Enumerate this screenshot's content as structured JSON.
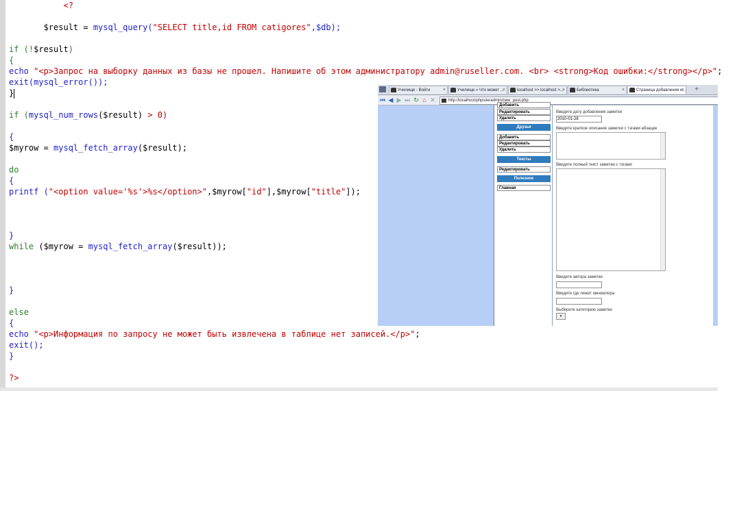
{
  "editor": {
    "lines": [
      {
        "y": 0,
        "parts": []
      },
      {
        "y": 1,
        "parts": []
      }
    ]
  },
  "code": {
    "l1": "<?",
    "l2_var": "$result = ",
    "l2_fn": "mysql_query",
    "l2_paren": "(",
    "l2_str": "\"SELECT title,id FROM catigores\"",
    "l2_tail": ",$db);",
    "l3_kw": "if (!",
    "l3_var": "$result",
    "l3_end": ")",
    "l4": "{",
    "l5_kw": "echo ",
    "l5_str": "\"<p>Запрос на выборку данных из базы не прошел. Напишите об этом администратору admin@ruseller.com. <br> <strong>Код ошибки:</strong></p>\"",
    "l5_end": ";",
    "l6_fn": "exit(mysql_error());",
    "l7": "}",
    "l8_kw": "if (",
    "l8_fn": "mysql_num_rows",
    "l8_var": "($result)",
    "l8_op": " > 0)",
    "l9": "{",
    "l10_var": "$myrow = ",
    "l10_fn": "mysql_fetch_array",
    "l10_tail": "($result);",
    "l11_kw": "do",
    "l12": "{",
    "l13_fn": "printf (",
    "l13_str": "\"<option value='%s'>%s</option>\"",
    "l13_mid": ",$myrow[",
    "l13_s1": "\"id\"",
    "l13_mid2": "],$myrow[",
    "l13_s2": "\"title\"",
    "l13_end": "]);",
    "l14": "}",
    "l15_kw": "while",
    "l15_var": " ($myrow = ",
    "l15_fn": "mysql_fetch_array",
    "l15_tail": "($result));",
    "l16": "}",
    "l17_kw": "else",
    "l18": "{",
    "l19_kw": "echo ",
    "l19_str": "\"<p>Информация по запросу не может быть извлечена в таблице нет записей.</p>\"",
    "l19_end": ";",
    "l20_fn": "exit();",
    "l21": "}",
    "l22": "?>"
  },
  "browser": {
    "tabs": [
      {
        "label": "Училище - Войти",
        "active": false
      },
      {
        "label": "Училище » Что может ...",
        "active": false
      },
      {
        "label": "localhost >> localhost >...",
        "active": false
      },
      {
        "label": "Библиотека",
        "active": false
      },
      {
        "label": "Страница добавления н...",
        "active": true
      }
    ],
    "new_tab": "+",
    "address": "http://localhost/phpsite/admin/new_post.php",
    "menu": {
      "top_partial": "Добавить",
      "items_a": [
        "Редактировать",
        "Удалить"
      ],
      "head_friends": "Друзья",
      "items_b": [
        "Добавить",
        "Редактировать",
        "Удалить"
      ],
      "head_texts": "Тексты",
      "items_c": [
        "Редактировать"
      ],
      "head_useful": "Полезное",
      "items_d": [
        "Главная"
      ]
    },
    "form": {
      "date_label": "Введите дату добавления заметки",
      "date_value": "2010-01-28",
      "short_label": "Введите краткое описание заметки с тэгами абзацев",
      "full_label": "Введите полный текст заметки с тэгами",
      "author_label": "Введите автора заметки",
      "mini_label": "Введите где лежит миниатюра",
      "category_label": "Выберите категорию заметки"
    }
  }
}
